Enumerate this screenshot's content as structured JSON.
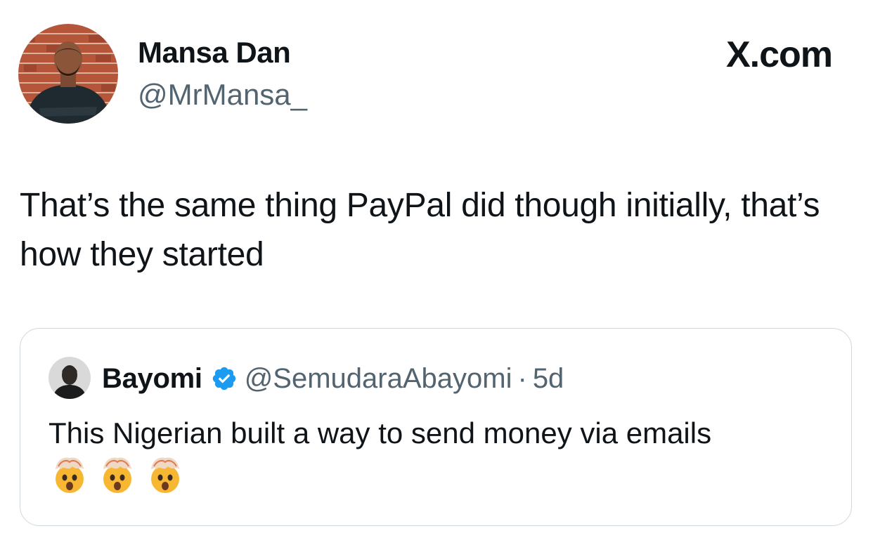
{
  "brand": {
    "label": "X.com"
  },
  "author": {
    "display_name": "Mansa Dan",
    "handle": "@MrMansa_",
    "avatar_icon": "profile-photo"
  },
  "tweet": {
    "text": "That’s the same thing PayPal did though initially, that’s how they started"
  },
  "quoted_tweet": {
    "display_name": "Bayomi",
    "handle": "@SemudaraAbayomi",
    "separator": "·",
    "time": "5d",
    "verified_icon": "verified-badge-icon",
    "text": "This Nigerian built a way to send money via emails",
    "emojis": [
      "exploding-head-emoji",
      "exploding-head-emoji",
      "exploding-head-emoji"
    ]
  },
  "colors": {
    "text_primary": "#0f1419",
    "text_secondary": "#536471",
    "border": "#cfd9de",
    "verified_blue": "#1d9bf0"
  }
}
